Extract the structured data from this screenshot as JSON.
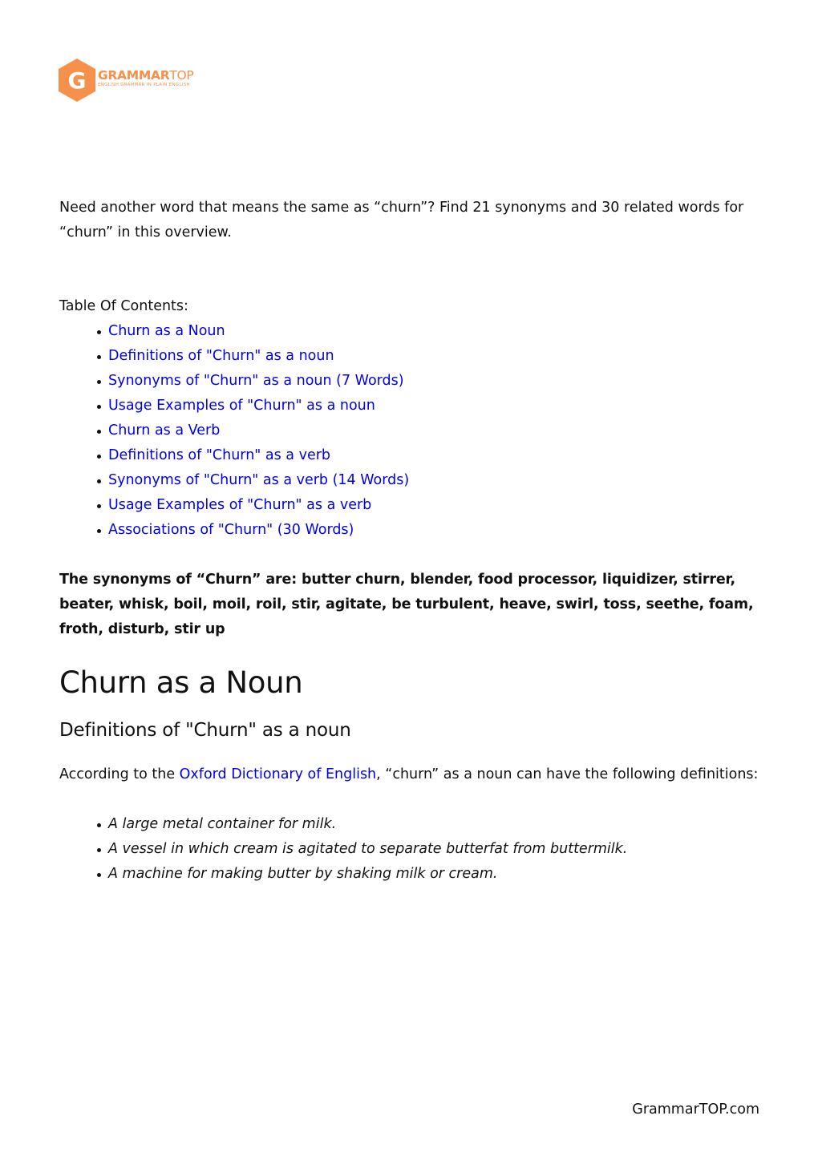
{
  "brand": {
    "logo_letter": "G",
    "name_part1": "GRAMMAR",
    "name_part2": "TOP",
    "tagline": "English Grammar in Plain English",
    "color": "#f5914a"
  },
  "intro": {
    "text": "Need another word that means the same as “churn”? Find 21 synonyms and 30 related words for “churn” in this overview."
  },
  "toc": {
    "title": "Table Of Contents:",
    "items": [
      {
        "label": "Churn as a Noun"
      },
      {
        "label": "Definitions of \"Churn\" as a noun"
      },
      {
        "label": "Synonyms of \"Churn\" as a noun (7 Words)"
      },
      {
        "label": "Usage Examples of \"Churn\" as a noun"
      },
      {
        "label": "Churn as a Verb"
      },
      {
        "label": "Definitions of \"Churn\" as a verb"
      },
      {
        "label": "Synonyms of \"Churn\" as a verb (14 Words)"
      },
      {
        "label": "Usage Examples of \"Churn\" as a verb"
      },
      {
        "label": "Associations of \"Churn\" (30 Words)"
      }
    ]
  },
  "summary": {
    "text": "The synonyms of “Churn” are: butter churn, blender, food processor, liquidizer, stirrer, beater, whisk, boil, moil, roil, stir, agitate, be turbulent, heave, swirl, toss, seethe, foam, froth, disturb, stir up"
  },
  "noun_section": {
    "title": "Churn as a Noun",
    "definitions_title": "Definitions of \"Churn\" as a noun",
    "definitions_intro_prefix": "According to the ",
    "definitions_intro_link": "Oxford Dictionary of English",
    "definitions_intro_suffix": ", “churn” as a noun can have the following definitions:",
    "definitions": [
      "A large metal container for milk.",
      "A vessel in which cream is agitated to separate butterfat from buttermilk.",
      "A machine for making butter by shaking milk or cream."
    ]
  },
  "footer": {
    "site": "GrammarTOP.com"
  },
  "colors": {
    "link": "#0000ee",
    "text": "#111111",
    "brand_orange": "#f5914a"
  }
}
